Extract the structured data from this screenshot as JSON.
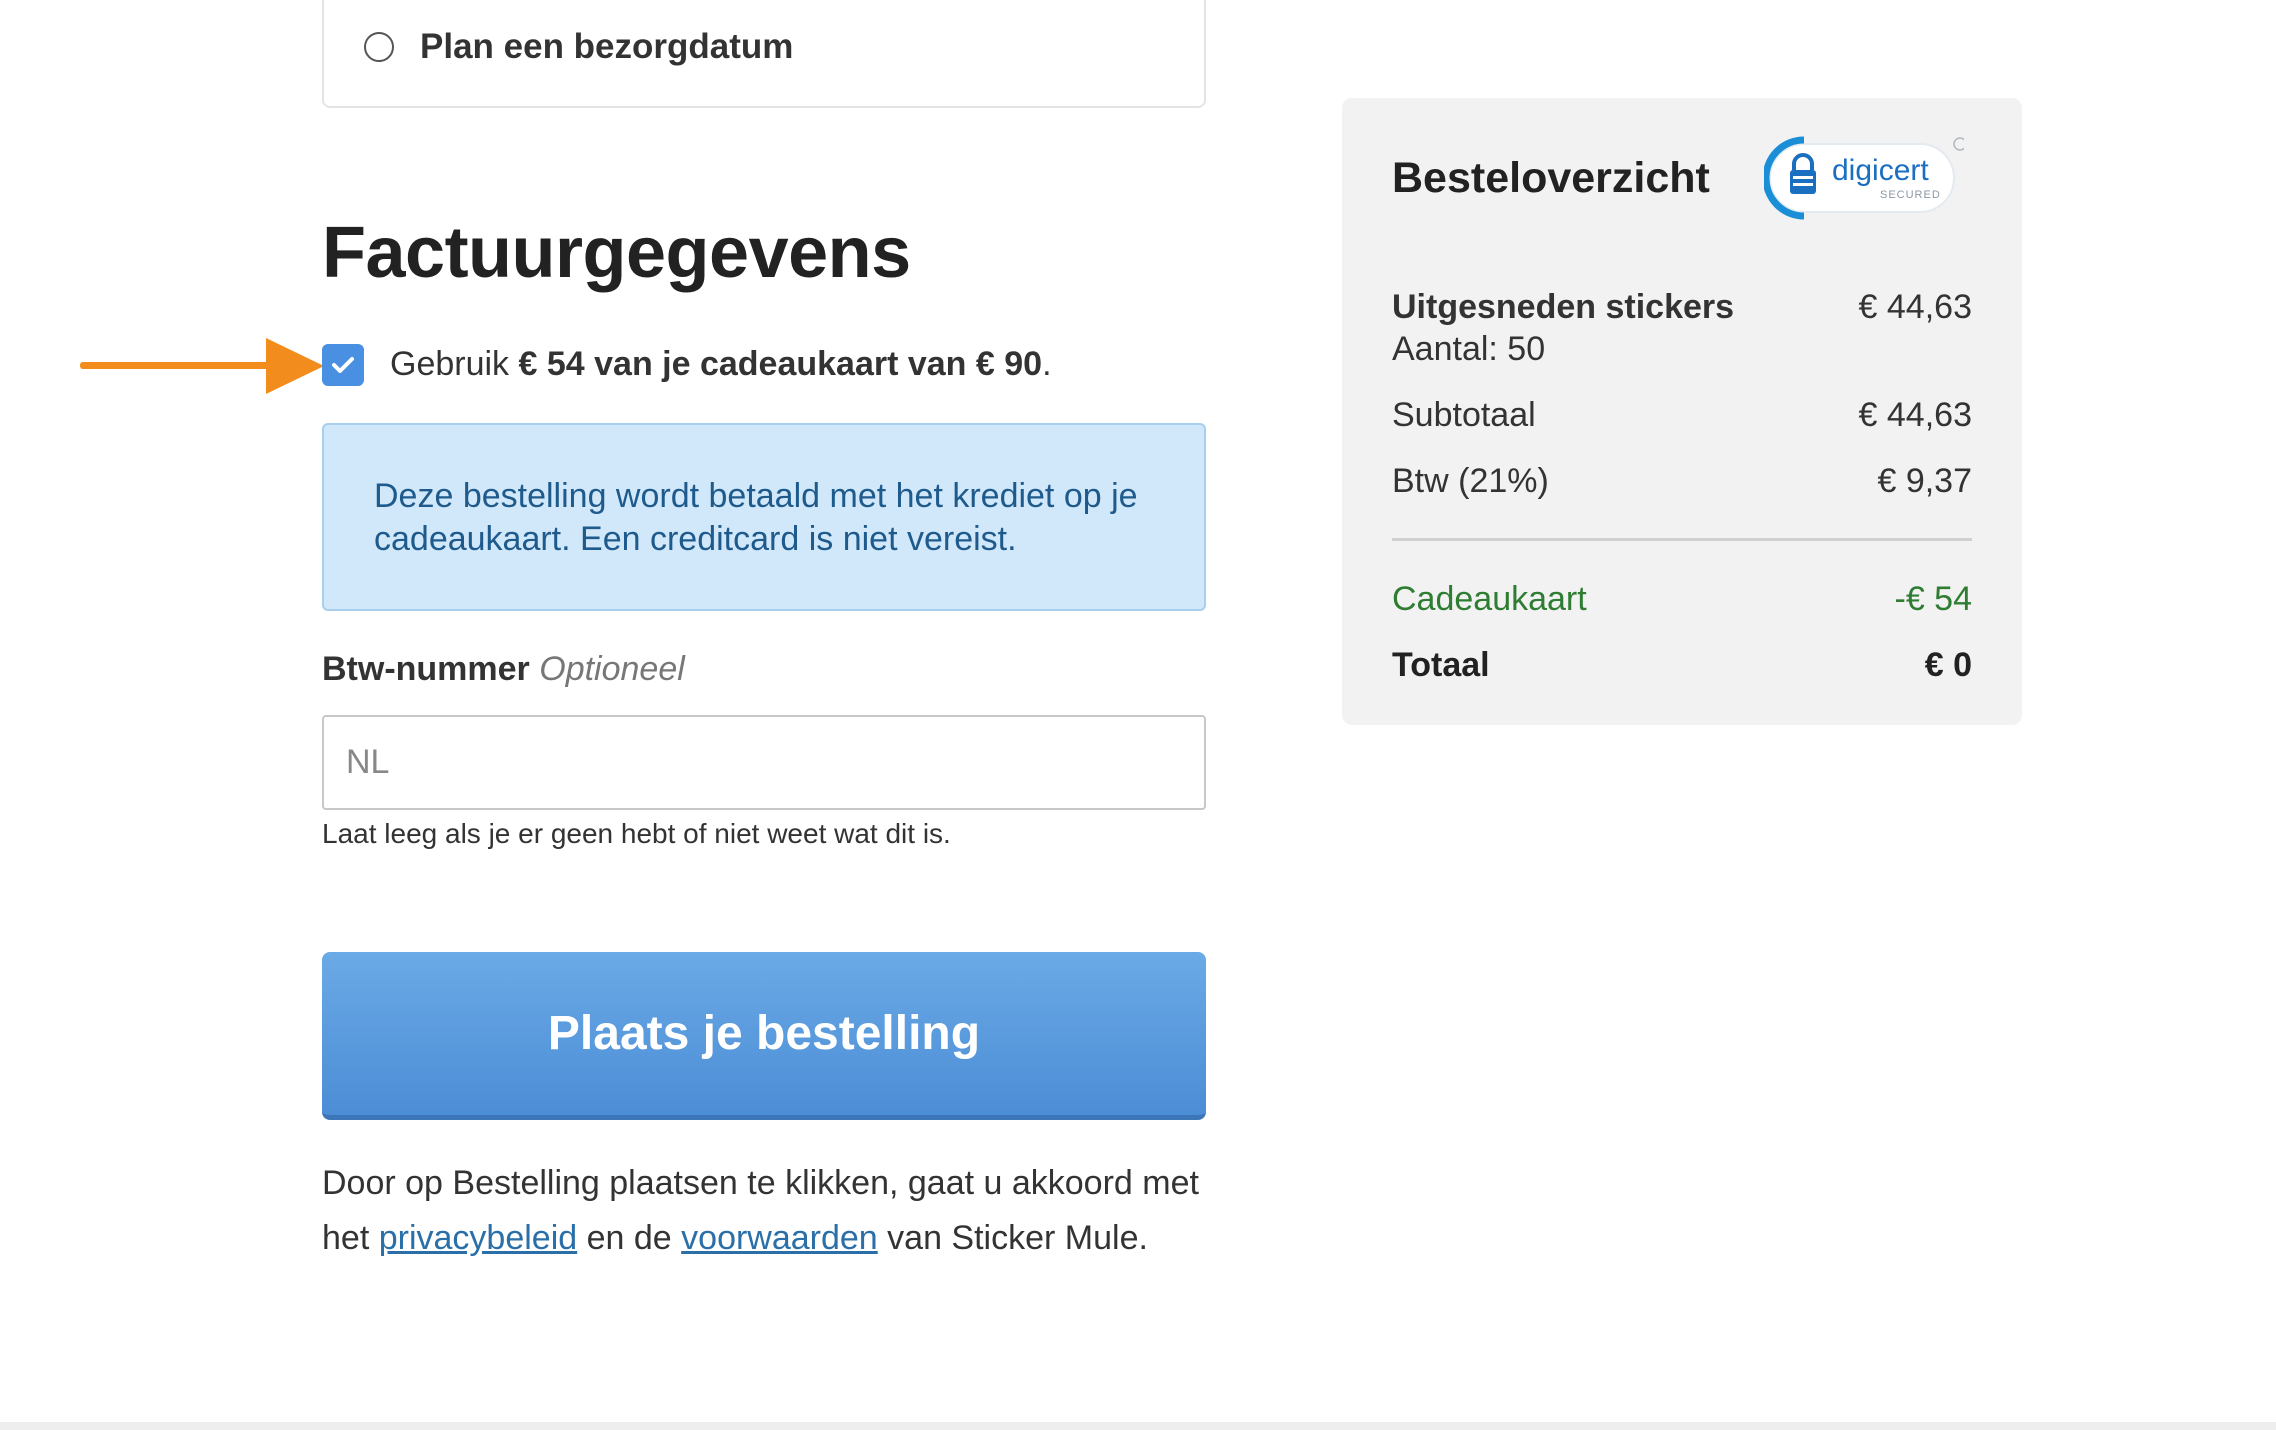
{
  "delivery": {
    "option_label": "Plan een bezorgdatum"
  },
  "billing": {
    "title": "Factuurgegevens",
    "giftcard_checkbox": {
      "checked": true,
      "prefix": "Gebruik ",
      "bold_text": "€ 54 van je cadeaukaart van € 90",
      "suffix": "."
    },
    "info_message": "Deze bestelling wordt betaald met het krediet op je cadeaukaart. Een creditcard is niet vereist.",
    "vat": {
      "label": "Btw-nummer",
      "optional": "Optioneel",
      "placeholder": "NL",
      "help": "Laat leeg als je er geen hebt of niet weet wat dit is."
    },
    "order_button": "Plaats je bestelling",
    "terms": {
      "part1": "Door op Bestelling plaatsen te klikken, gaat u akkoord met het ",
      "privacy_link": "privacybeleid",
      "part2": " en de ",
      "terms_link": "voorwaarden",
      "part3": " van Sticker Mule."
    }
  },
  "summary": {
    "title": "Besteloverzicht",
    "badge_text": "digicert",
    "badge_subtext": "SECURED",
    "product": {
      "name": "Uitgesneden stickers",
      "price": "€ 44,63",
      "quantity": "Aantal: 50"
    },
    "subtotal": {
      "label": "Subtotaal",
      "value": "€ 44,63"
    },
    "vat": {
      "label": "Btw (21%)",
      "value": "€ 9,37"
    },
    "giftcard": {
      "label": "Cadeaukaart",
      "value": "-€ 54"
    },
    "total": {
      "label": "Totaal",
      "value": "€ 0"
    }
  },
  "colors": {
    "accent_blue": "#4a90e2",
    "annotation_arrow": "#f28c1c",
    "info_bg": "#d1e8fa",
    "info_text": "#1e5a8c",
    "giftcard_green": "#2e7d32"
  }
}
